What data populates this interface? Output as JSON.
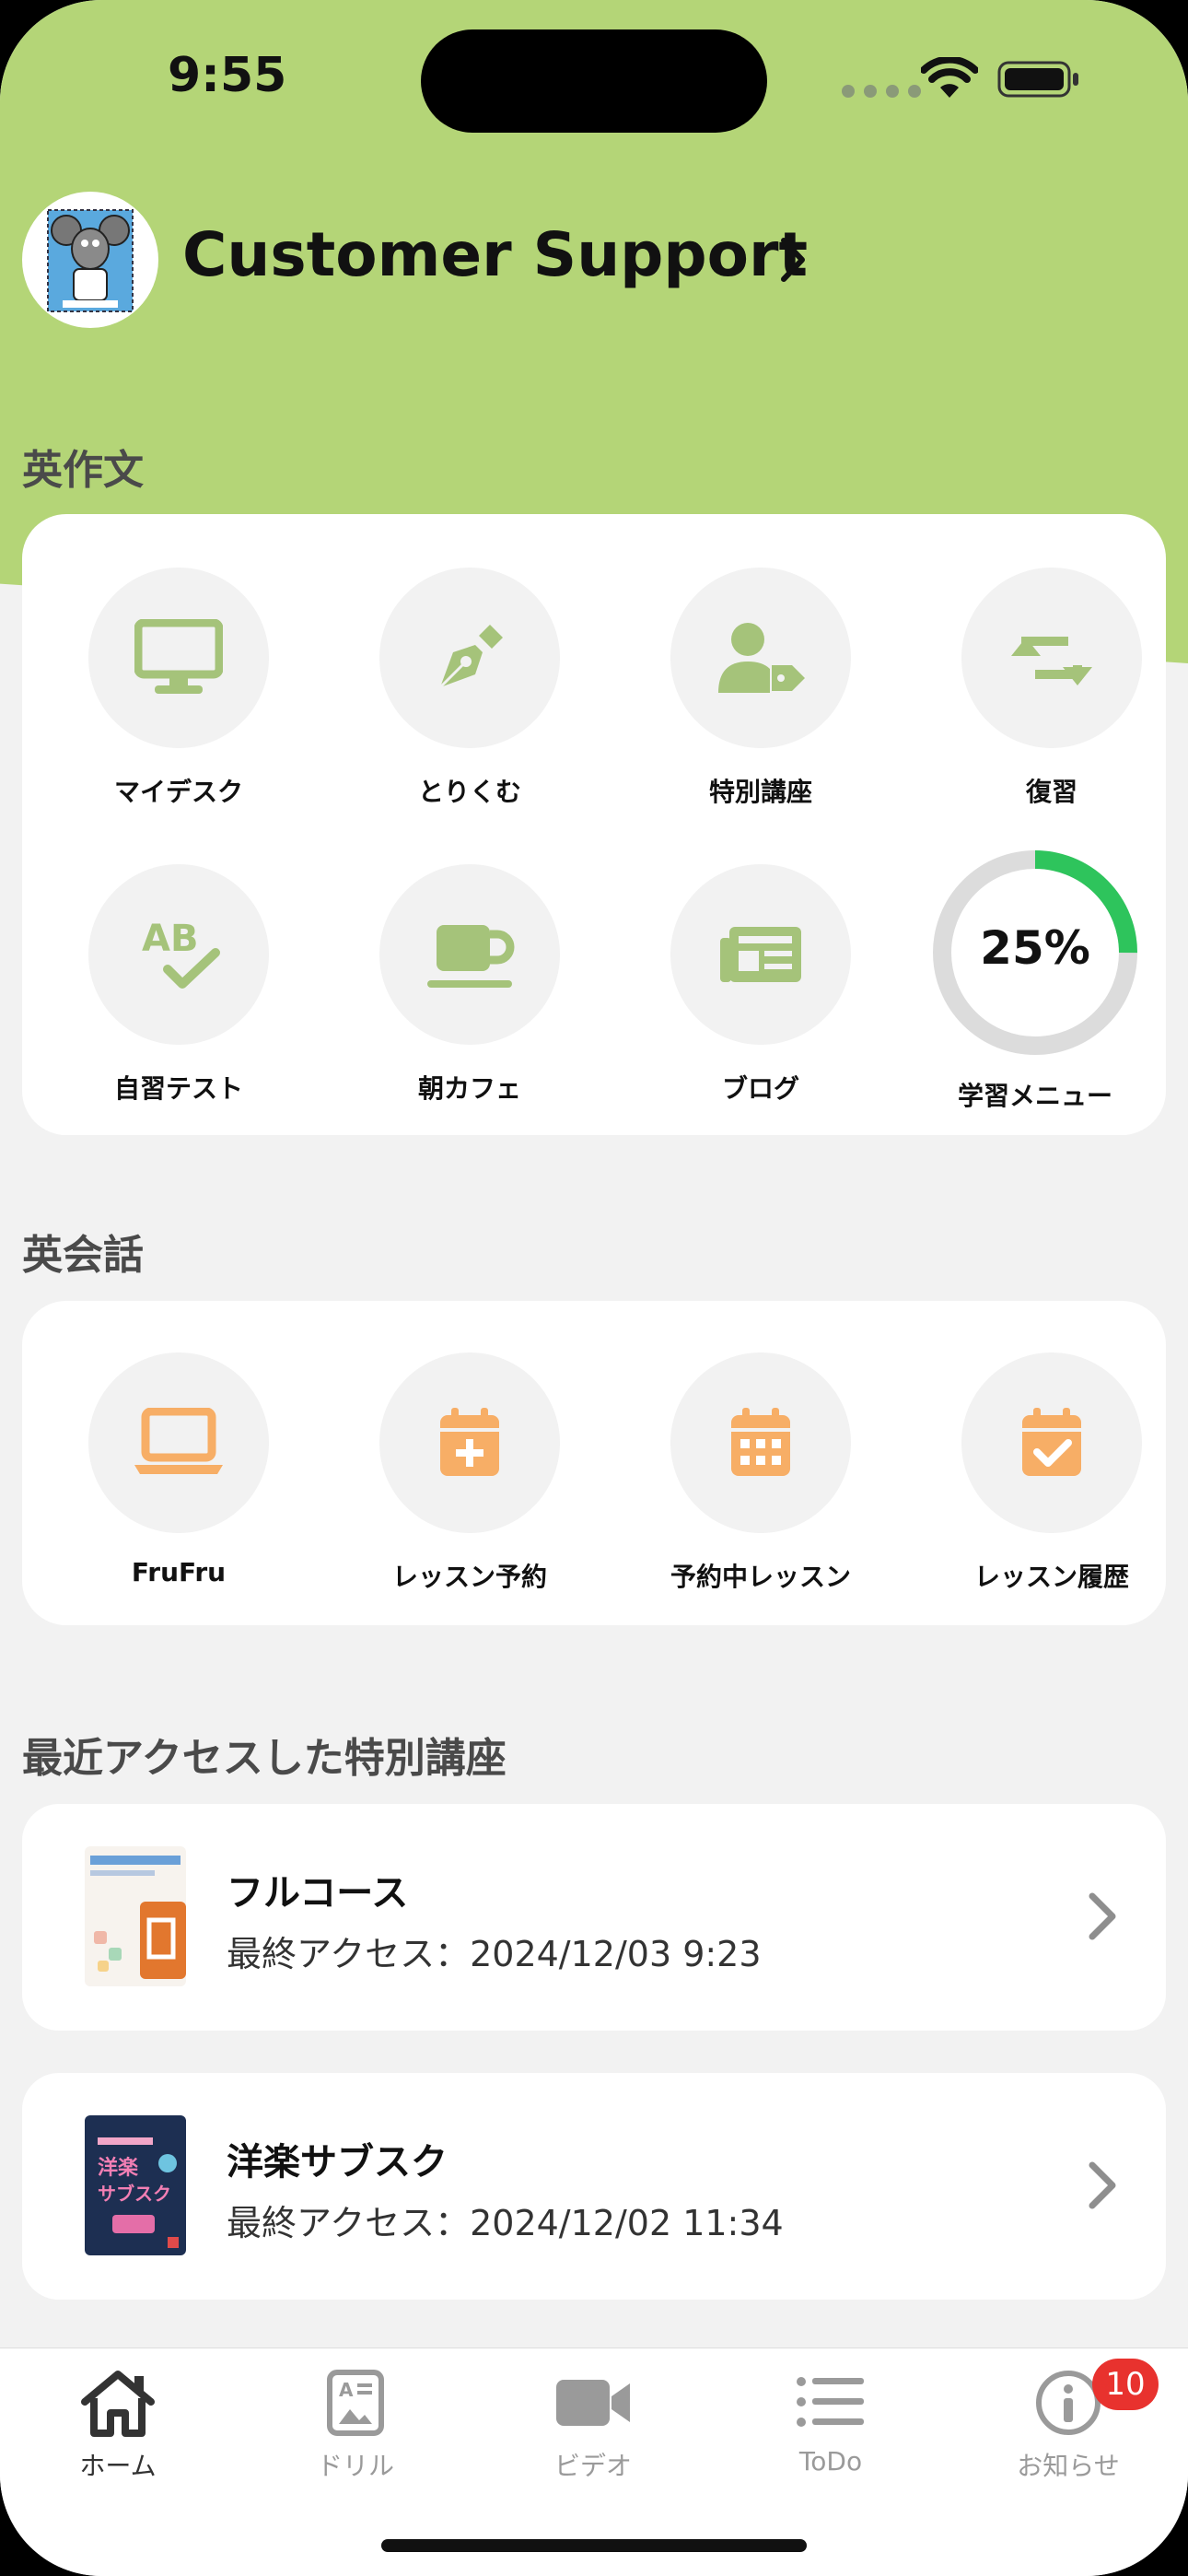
{
  "status_bar": {
    "time": "9:55"
  },
  "header": {
    "title": "Customer Support"
  },
  "colors": {
    "hero": "#b4d577",
    "green_icon": "#a5c37a",
    "orange_icon": "#f7ae66",
    "progress": "#2ec45c",
    "badge": "#e8322e"
  },
  "writing": {
    "section_title": "英作文",
    "tiles": [
      {
        "label": "マイデスク",
        "icon": "monitor-icon"
      },
      {
        "label": "とりくむ",
        "icon": "pen-nib-icon"
      },
      {
        "label": "特別講座",
        "icon": "user-tag-icon"
      },
      {
        "label": "復習",
        "icon": "repeat-icon"
      },
      {
        "label": "自習テスト",
        "icon": "spell-check-icon"
      },
      {
        "label": "朝カフェ",
        "icon": "coffee-cup-icon"
      },
      {
        "label": "ブログ",
        "icon": "newspaper-icon"
      }
    ],
    "progress": {
      "value": 25,
      "text": "25%",
      "label": "学習メニュー"
    }
  },
  "conversation": {
    "section_title": "英会話",
    "tiles": [
      {
        "label": "FruFru",
        "icon": "laptop-icon"
      },
      {
        "label": "レッスン予約",
        "icon": "calendar-plus-icon"
      },
      {
        "label": "予約中レッスン",
        "icon": "calendar-grid-icon"
      },
      {
        "label": "レッスン履歴",
        "icon": "calendar-check-icon"
      }
    ]
  },
  "recent": {
    "section_title": "最近アクセスした特別講座",
    "items": [
      {
        "title": "フルコース",
        "subtitle": "最終アクセス：2024/12/03 9:23"
      },
      {
        "title": "洋楽サブスク",
        "subtitle": "最終アクセス：2024/12/02 11:34"
      }
    ]
  },
  "tabbar": {
    "tabs": [
      {
        "label": "ホーム",
        "icon": "home-icon"
      },
      {
        "label": "ドリル",
        "icon": "drill-icon"
      },
      {
        "label": "ビデオ",
        "icon": "video-icon"
      },
      {
        "label": "ToDo",
        "icon": "list-icon"
      },
      {
        "label": "お知らせ",
        "icon": "info-icon"
      }
    ],
    "badge_count": "10"
  }
}
